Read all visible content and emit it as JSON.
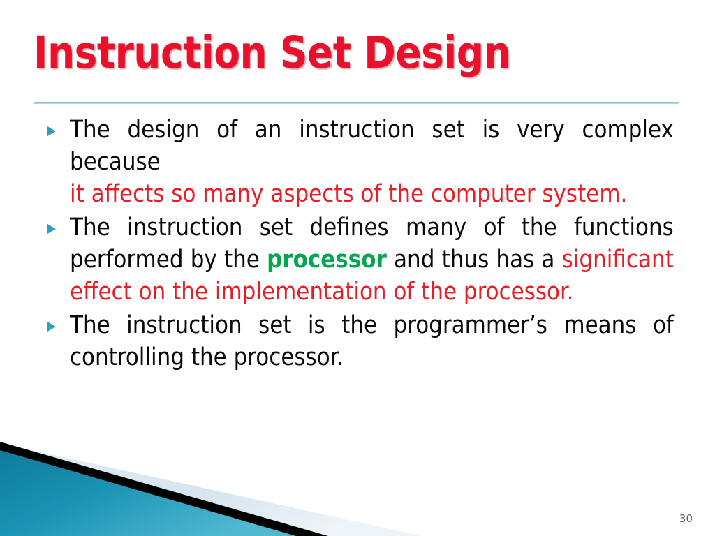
{
  "slide": {
    "title": "Instruction Set Design",
    "slide_number": "30",
    "colors": {
      "title_red": "#e8102a",
      "highlight_red": "#ed1c24",
      "highlight_green": "#00a650",
      "bullet_teal": "#2e9fbd",
      "rule_teal": "#6fb6c4",
      "footer_teal": "#1b8fb0",
      "footer_black": "#000000",
      "footer_pale_blue": "#dce8f0",
      "body_text": "#0a0a0a",
      "slide_number_gray": "#5f5f5f",
      "background": "#ffffff"
    },
    "bullets": [
      {
        "marker": "triangle-right",
        "segments": [
          {
            "text": "The design of an instruction set is very complex because ",
            "style": "normal"
          },
          {
            "text": "it affects so many aspects of the computer system.",
            "style": "red"
          }
        ],
        "plain_text": "The design of an instruction set is very complex because it affects so many aspects of the computer system."
      },
      {
        "marker": "triangle-right",
        "segments": [
          {
            "text": "The instruction set defines many of the functions performed by the ",
            "style": "normal"
          },
          {
            "text": "processor",
            "style": "green-bold"
          },
          {
            "text": " and thus has a ",
            "style": "normal"
          },
          {
            "text": "significant effect on the implementation of the processor.",
            "style": "red"
          }
        ],
        "plain_text": "The instruction set defines many of the functions performed by the processor and thus has a significant effect on the implementation of the processor."
      },
      {
        "marker": "triangle-right",
        "segments": [
          {
            "text": "The instruction set is the programmer’s means of controlling the processor.",
            "style": "normal"
          }
        ],
        "plain_text": "The instruction set is the programmer’s means of controlling the processor."
      }
    ]
  }
}
